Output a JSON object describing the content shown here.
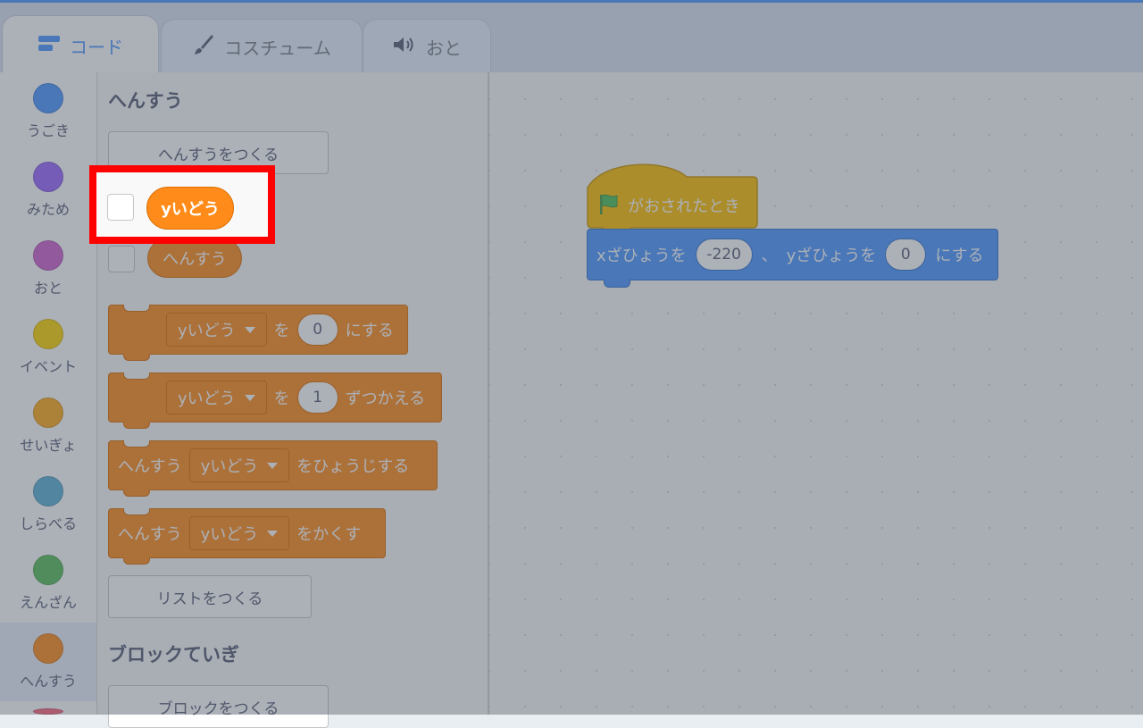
{
  "tabs": {
    "code": "コード",
    "costumes": "コスチューム",
    "sounds": "おと"
  },
  "categories": [
    {
      "label": "うごき",
      "color": "#4c97ff"
    },
    {
      "label": "みため",
      "color": "#9966ff"
    },
    {
      "label": "おと",
      "color": "#cf63cf"
    },
    {
      "label": "イベント",
      "color": "#ffd500"
    },
    {
      "label": "せいぎょ",
      "color": "#ffab19"
    },
    {
      "label": "しらべる",
      "color": "#5cb1d6"
    },
    {
      "label": "えんざん",
      "color": "#59c059"
    },
    {
      "label": "へんすう",
      "color": "#ff8c1a"
    }
  ],
  "palette": {
    "variables_heading": "へんすう",
    "make_variable": "へんすうをつくる",
    "var_y": "yいどう",
    "var_default": "へんすう",
    "set_block": {
      "var": "yいどう",
      "word_wo": "を",
      "value": "0",
      "suffix": "にする"
    },
    "change_block": {
      "var": "yいどう",
      "word_wo": "を",
      "value": "1",
      "suffix": "ずつかえる"
    },
    "show_block": {
      "prefix": "へんすう",
      "var": "yいどう",
      "suffix": "をひょうじする"
    },
    "hide_block": {
      "prefix": "へんすう",
      "var": "yいどう",
      "suffix": "をかくす"
    },
    "make_list": "リストをつくる",
    "myblocks_heading": "ブロックていぎ",
    "make_block": "ブロックをつくる"
  },
  "workspace": {
    "hat_label": "がおされたとき",
    "goto": {
      "x_label": "xざひょうを",
      "x_value": "-220",
      "sep": "、",
      "y_label": "yざひょうを",
      "y_value": "0",
      "suffix": "にする"
    }
  },
  "colors": {
    "accent": "#4c97ff",
    "variables": "#ff8c1a",
    "events": "#ffbf00",
    "motion": "#4c97ff",
    "highlight_border": "#ff0000"
  }
}
